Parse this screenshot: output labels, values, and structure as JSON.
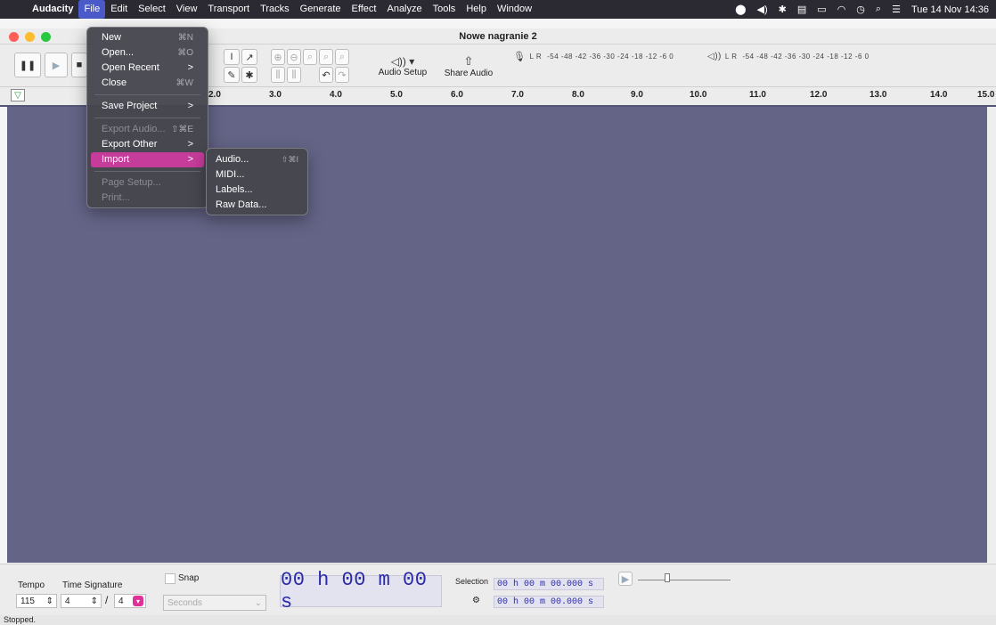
{
  "menubar": {
    "app_name": "Audacity",
    "items": [
      "File",
      "Edit",
      "Select",
      "View",
      "Transport",
      "Tracks",
      "Generate",
      "Effect",
      "Analyze",
      "Tools",
      "Help",
      "Window"
    ],
    "clock": "Tue 14 Nov  14:36"
  },
  "window": {
    "title": "Nowe nagranie 2"
  },
  "toolbar": {
    "audio_setup_label": "Audio Setup",
    "share_audio_label": "Share Audio",
    "meter_scale": "-54 -48 -42 -36 -30 -24 -18 -12 -6 0",
    "meter_lr": "L R"
  },
  "ruler": {
    "ticks": [
      "2.0",
      "3.0",
      "4.0",
      "5.0",
      "6.0",
      "7.0",
      "8.0",
      "9.0",
      "10.0",
      "11.0",
      "12.0",
      "13.0",
      "14.0",
      "15.0"
    ]
  },
  "file_menu": {
    "new": {
      "label": "New",
      "shortcut": "⌘N"
    },
    "open": {
      "label": "Open...",
      "shortcut": "⌘O"
    },
    "open_recent": {
      "label": "Open Recent",
      "arrow": ">"
    },
    "close": {
      "label": "Close",
      "shortcut": "⌘W"
    },
    "save_project": {
      "label": "Save Project",
      "arrow": ">"
    },
    "export_audio": {
      "label": "Export Audio...",
      "shortcut": "⇧⌘E"
    },
    "export_other": {
      "label": "Export Other",
      "arrow": ">"
    },
    "import": {
      "label": "Import",
      "arrow": ">"
    },
    "page_setup": {
      "label": "Page Setup..."
    },
    "print": {
      "label": "Print..."
    }
  },
  "import_submenu": {
    "audio": {
      "label": "Audio...",
      "shortcut": "⇧⌘I"
    },
    "midi": {
      "label": "MIDI..."
    },
    "labels": {
      "label": "Labels..."
    },
    "raw_data": {
      "label": "Raw Data..."
    }
  },
  "bottom": {
    "tempo_label": "Tempo",
    "tempo_value": "115",
    "time_signature_label": "Time Signature",
    "ts_numerator": "4",
    "ts_slash": "/",
    "ts_denominator": "4",
    "snap_label": "Snap",
    "snap_unit": "Seconds",
    "big_time": "00 h 00 m 00 s",
    "selection_label": "Selection",
    "selection_start": "00 h 00 m 00.000 s",
    "selection_end": "00 h 00 m 00.000 s"
  },
  "status": {
    "text": "Stopped."
  },
  "colors": {
    "track_bg": "#646487",
    "menu_highlight": "#c53c9a",
    "time_text": "#2a2aa8"
  }
}
